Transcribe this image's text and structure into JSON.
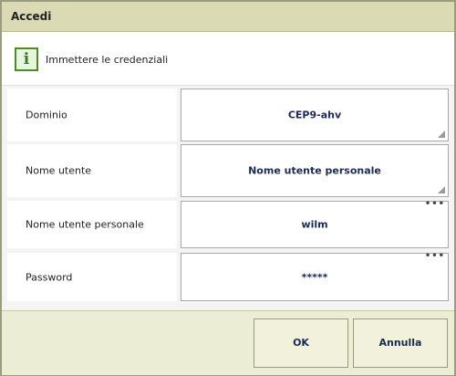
{
  "dialog": {
    "title": "Accedi",
    "info_icon": "info-icon",
    "message": "Immettere le credenziali"
  },
  "fields": [
    {
      "label": "Dominio",
      "value": "CEP9-ahv"
    },
    {
      "label": "Nome utente",
      "value": "Nome utente personale"
    },
    {
      "label": "Nome utente personale",
      "value": "wilm"
    },
    {
      "label": "Password",
      "value": "*****"
    }
  ],
  "buttons": {
    "ok": "OK",
    "cancel": "Annulla"
  },
  "colors": {
    "title_bar": "#dadbb4",
    "footer": "#ecedd5",
    "info_green": "#4c8a2a"
  }
}
